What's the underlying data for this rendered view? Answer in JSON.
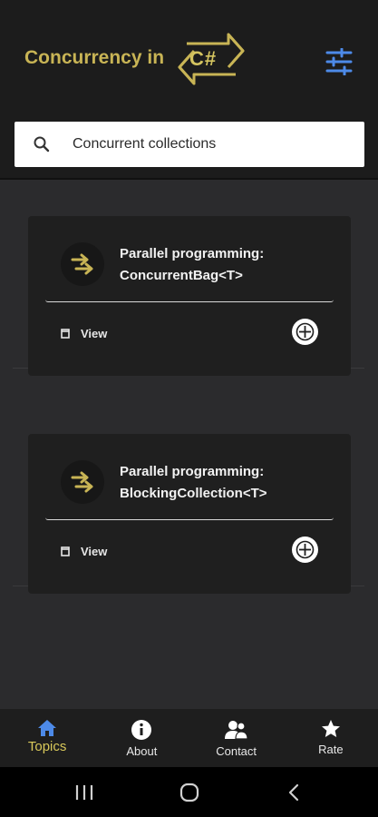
{
  "header": {
    "title": "Concurrency in",
    "logo_text": "C#"
  },
  "search": {
    "value": "Concurrent collections",
    "placeholder": "Search"
  },
  "cards": [
    {
      "title_line1": "Parallel programming:",
      "title_line2": "ConcurrentBag<T>",
      "view_label": "View"
    },
    {
      "title_line1": "Parallel programming:",
      "title_line2": "BlockingCollection<T>",
      "view_label": "View"
    }
  ],
  "bottom_nav": [
    {
      "label": "Topics",
      "icon": "home-icon",
      "active": true
    },
    {
      "label": "About",
      "icon": "info-icon",
      "active": false
    },
    {
      "label": "Contact",
      "icon": "contact-icon",
      "active": false
    },
    {
      "label": "Rate",
      "icon": "star-icon",
      "active": false
    }
  ],
  "colors": {
    "accent": "#c8b455",
    "active_nav_icon": "#4d8ae8",
    "filter_icon": "#4d8ae8",
    "background": "#2b2b2d",
    "card": "#1f1f1f",
    "header": "#1c1c1c"
  },
  "system_bar": {
    "buttons": [
      "recents-icon",
      "home-circle-icon",
      "back-icon"
    ]
  }
}
